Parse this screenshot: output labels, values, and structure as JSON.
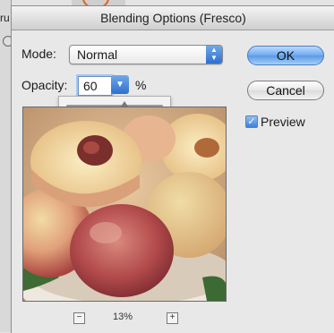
{
  "background": {
    "partial_text": "ru"
  },
  "dialog": {
    "title": "Blending Options (Fresco)",
    "mode": {
      "label": "Mode:",
      "value": "Normal"
    },
    "opacity": {
      "label": "Opacity:",
      "value": "60",
      "unit": "%",
      "slider_fraction": 0.6
    },
    "buttons": {
      "ok": "OK",
      "cancel": "Cancel"
    },
    "preview": {
      "label": "Preview",
      "checked": true
    },
    "zoom": {
      "value": "13%",
      "minus": "−",
      "plus": "+"
    }
  },
  "colors": {
    "accent_blue": "#3f7fd8"
  }
}
